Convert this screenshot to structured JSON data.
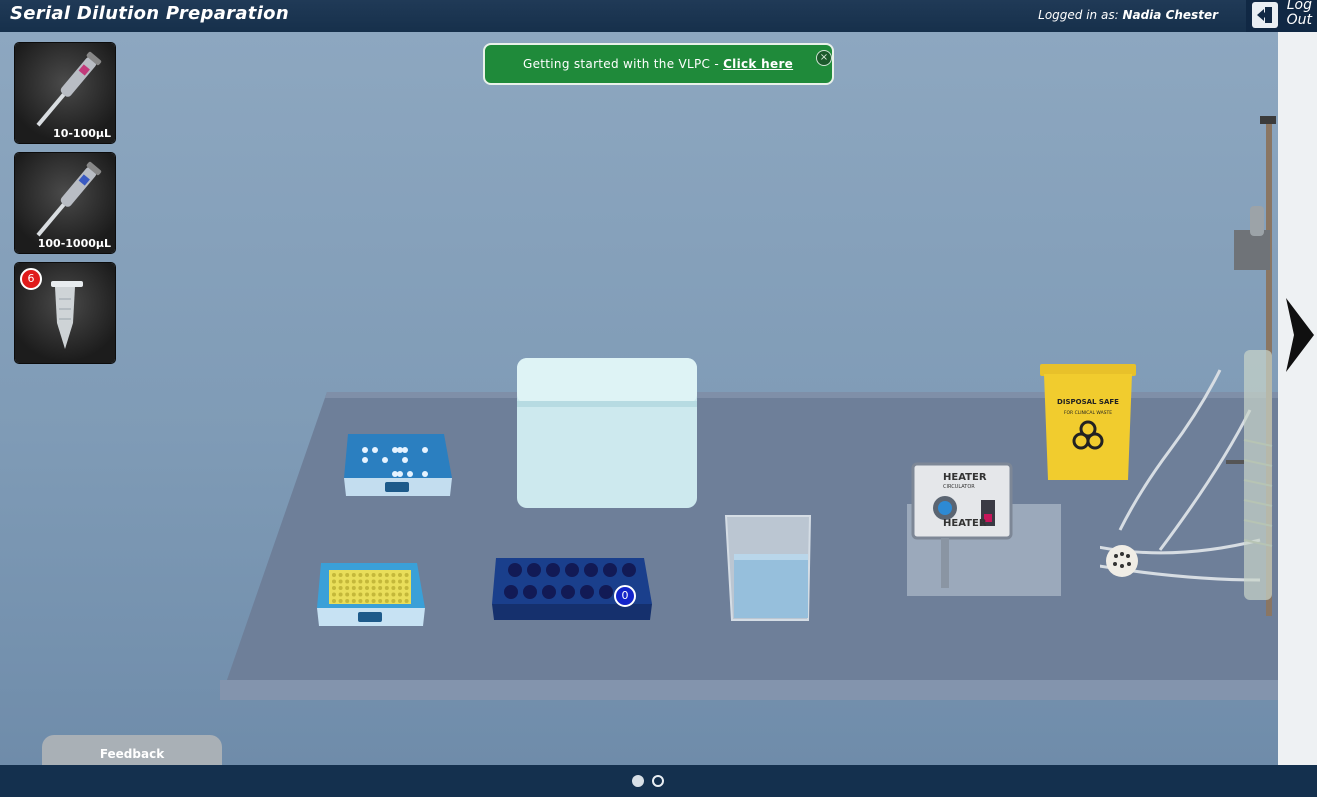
{
  "header": {
    "title": "Serial Dilution Preparation",
    "logged_in_prefix": "Logged in as:",
    "user_name": "Nadia Chester",
    "logout_line1": "Log",
    "logout_line2": "Out"
  },
  "banner": {
    "message": "Getting started with the VLPC - ",
    "link_text": "Click here",
    "close_icon": "close-icon"
  },
  "tools": [
    {
      "name": "pipette-10-100",
      "label": "10-100µL",
      "icon": "pipette-icon"
    },
    {
      "name": "pipette-100-1000",
      "label": "100-1000µL",
      "icon": "pipette-icon"
    },
    {
      "name": "microcentrifuge-tube",
      "label": "",
      "icon": "tube-icon",
      "badge": "6"
    }
  ],
  "bench": {
    "tube_rack_counter": "0",
    "heater_label": "HEATER",
    "heater_sublabel": "CIRCULATOR",
    "disposal_label": "DISPOSAL SAFE",
    "disposal_sublabel": "FOR CLINICAL WASTE"
  },
  "footer": {
    "feedback_label": "Feedback",
    "pages": 2,
    "current_page": 1
  },
  "colors": {
    "topbar": "#16304b",
    "banner": "#1f8a3a",
    "badge_red": "#e01b1b",
    "counter_blue": "#1324c9"
  }
}
